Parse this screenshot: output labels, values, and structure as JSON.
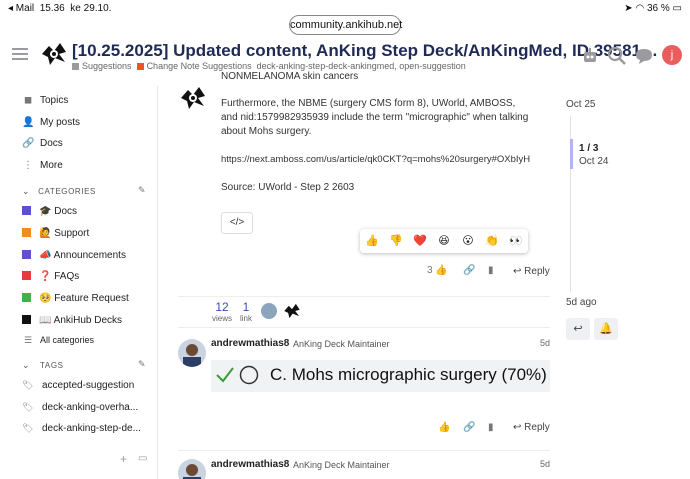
{
  "statusbar": {
    "back_app": "◂ Mail",
    "time": "15.36",
    "date": "ke 29.10.",
    "battery": "36 %"
  },
  "browser": {
    "url": "community.ankihub.net"
  },
  "topic": {
    "title": "[10.25.2025] Updated content, AnKing Step Deck/AnKingMed, ID 39581…",
    "category": "Suggestions",
    "subcategory": "Change Note Suggestions",
    "tags": "deck-anking-step-deck-ankingmed, open-suggestion"
  },
  "sidebar": {
    "nav": [
      {
        "label": "Topics",
        "icon": "topics-icon",
        "glyph": "◼"
      },
      {
        "label": "My posts",
        "icon": "user-icon",
        "glyph": "👤"
      },
      {
        "label": "Docs",
        "icon": "link-icon",
        "glyph": "🔗"
      },
      {
        "label": "More",
        "icon": "more-icon",
        "glyph": "⋮"
      }
    ],
    "categories_heading": "CATEGORIES",
    "categories": [
      {
        "label": "🎓 Docs",
        "color": "#5b4fd8"
      },
      {
        "label": "🙋 Support",
        "color": "#f28c1e"
      },
      {
        "label": "📣 Announcements",
        "color": "#6450cc"
      },
      {
        "label": "❓ FAQs",
        "color": "#e53c3c"
      },
      {
        "label": "🥺 Feature Request",
        "color": "#3bb54a"
      },
      {
        "label": "📖 AnkiHub Decks",
        "color": "#111111"
      }
    ],
    "all_categories": "All categories",
    "tags_heading": "TAGS",
    "tags": [
      "accepted-suggestion",
      "deck-anking-overha...",
      "deck-anking-step-de..."
    ]
  },
  "post1": {
    "lines": [
      "NONMELANOMA skin cancers",
      "Furthermore, the NBME (surgery CMS form 8), UWorld, AMBOSS, and nid:1579982935939 include the term \"micrographic\" when talking about Mohs surgery.",
      "https://next.amboss.com/us/article/qk0CKT?q=mohs%20surgery#OXbIyH",
      "Source: UWorld - Step 2 2603"
    ],
    "code_button": "</>",
    "reactions": [
      "👍",
      "👎",
      "❤️",
      "😆",
      "😮",
      "👏",
      "👀"
    ],
    "like_count": "3",
    "reply_label": "Reply"
  },
  "stats": {
    "views": "12",
    "views_label": "views",
    "links": "1",
    "links_label": "link"
  },
  "post2": {
    "username": "andrewmathias8",
    "user_title": "AnKing Deck Maintainer",
    "date": "5d",
    "answer": "C.  Mohs micrographic surgery (70%)",
    "reply_label": "Reply"
  },
  "post3": {
    "username": "andrewmathias8",
    "user_title": "AnKing Deck Maintainer",
    "date": "5d"
  },
  "timeline": {
    "start": "Oct 25",
    "position": "1 / 3",
    "position_date": "Oct 24",
    "end": "5d ago"
  }
}
